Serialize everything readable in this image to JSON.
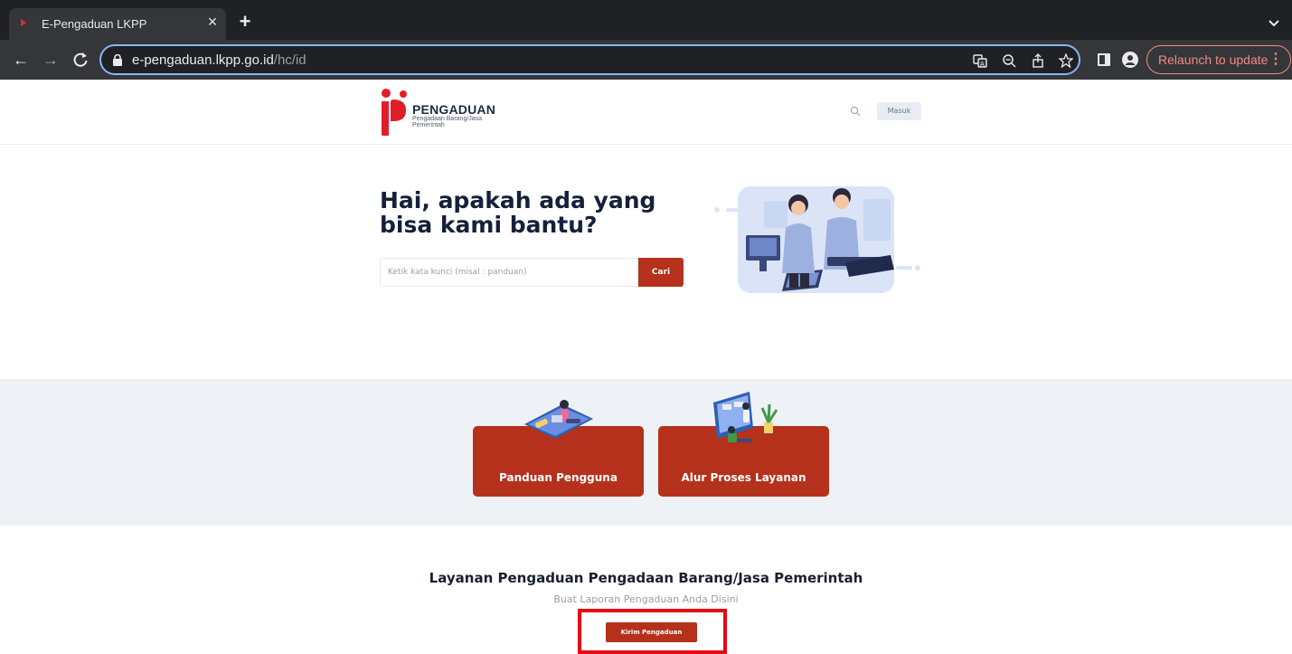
{
  "browser": {
    "tab": {
      "title": "E-Pengaduan LKPP"
    },
    "url": {
      "host": "e-pengaduan.lkpp.go.id",
      "path": "/hc/id"
    },
    "relaunch_label": "Relaunch to update"
  },
  "header": {
    "logo": {
      "title": "PENGADUAN",
      "subtitle_line1": "Pengadaan Barang/Jasa",
      "subtitle_line2": "Pemerintah"
    },
    "login_label": "Masuk"
  },
  "hero": {
    "title": "Hai, apakah ada yang bisa kami bantu?",
    "search_placeholder": "Ketik kata kunci (misal : panduan)",
    "search_button": "Cari"
  },
  "cards": [
    {
      "label": "Panduan Pengguna"
    },
    {
      "label": "Alur Proses Layanan"
    }
  ],
  "cta": {
    "title": "Layanan Pengaduan Pengadaan Barang/Jasa Pemerintah",
    "subtitle": "Buat Laporan Pengaduan Anda Disini",
    "button": "Kirim Pengaduan"
  },
  "colors": {
    "brand_red": "#b5311b",
    "highlight": "#e50914",
    "chrome_dark": "#202124",
    "omnibox_focus": "#8ab4f8"
  }
}
